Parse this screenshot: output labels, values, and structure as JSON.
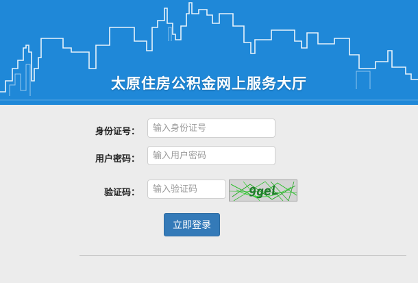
{
  "banner": {
    "title": "太原住房公积金网上服务大厅",
    "background_color": "#1f88d8",
    "skyline_color": "#ffffff"
  },
  "form": {
    "id_number": {
      "label": "身份证号：",
      "placeholder": "输入身份证号",
      "value": ""
    },
    "password": {
      "label": "用户密码：",
      "placeholder": "输入用户密码",
      "value": ""
    },
    "captcha": {
      "label": "验证码：",
      "placeholder": "输入验证码",
      "value": "",
      "image_text": "9geL"
    },
    "submit_label": "立即登录",
    "submit_color": "#347ab8"
  }
}
